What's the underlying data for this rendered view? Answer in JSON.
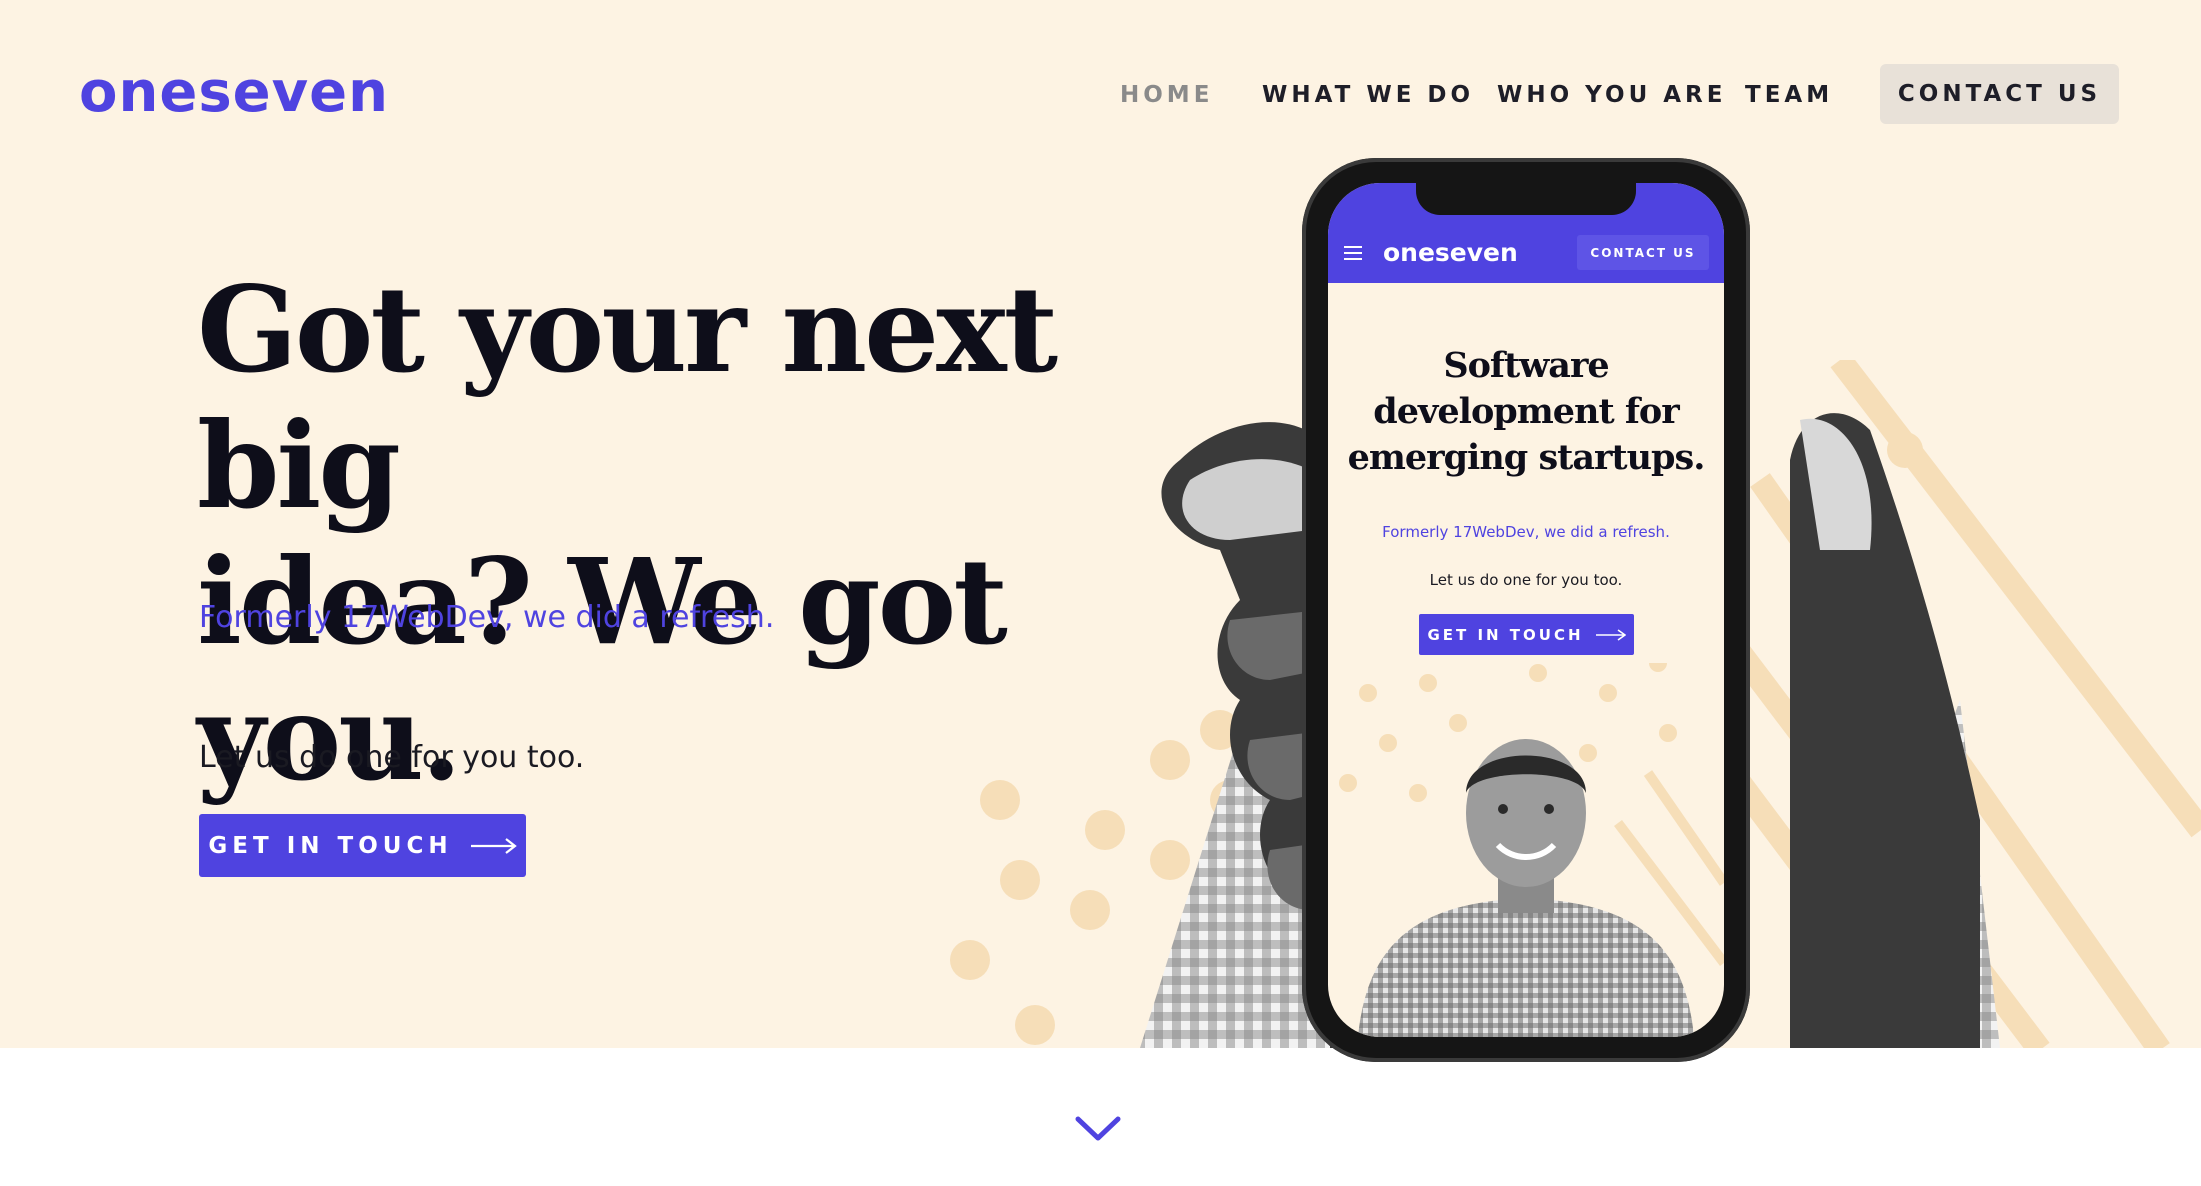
{
  "brand": {
    "logo": "oneseven",
    "accent": "#4f43e0",
    "hero_bg": "#fdf3e3"
  },
  "nav": {
    "items": [
      {
        "label": "HOME",
        "active": true
      },
      {
        "label": "WHAT WE DO",
        "active": false
      },
      {
        "label": "WHO YOU ARE",
        "active": false
      },
      {
        "label": "TEAM",
        "active": false
      }
    ],
    "contact_label": "CONTACT US"
  },
  "hero": {
    "headline_line1": "Got your next big",
    "headline_line2": "idea? We got you.",
    "subtitle": "Formerly 17WebDev, we did a refresh.",
    "tagline": "Let us do one for you too.",
    "cta_label": "GET IN TOUCH",
    "cta_icon": "arrow-right-icon"
  },
  "phone_mockup": {
    "logo": "oneseven",
    "menu_icon": "hamburger-icon",
    "contact_label": "CONTACT US",
    "headline_line1": "Software",
    "headline_line2": "development for",
    "headline_line3": "emerging startups.",
    "subtitle": "Formerly 17WebDev, we did a refresh.",
    "tagline": "Let us do one for you too.",
    "cta_label": "GET IN TOUCH"
  },
  "scroll": {
    "icon": "chevron-down-icon"
  }
}
